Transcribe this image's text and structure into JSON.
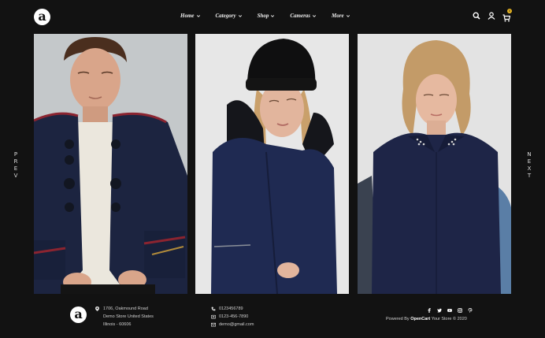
{
  "header": {
    "logo_letter": "a",
    "nav": [
      {
        "label": "Home"
      },
      {
        "label": "Category"
      },
      {
        "label": "Shop"
      },
      {
        "label": "Cameras"
      },
      {
        "label": "More"
      }
    ],
    "icons": [
      "search-icon",
      "user-icon",
      "cart-icon"
    ],
    "cart_count": "0"
  },
  "slider": {
    "prev_label": [
      "P",
      "R",
      "E",
      "V"
    ],
    "next_label": [
      "N",
      "E",
      "X",
      "T"
    ],
    "panels": [
      "model-photo-man-navy-jacket",
      "model-photo-woman-beanie-coat",
      "model-photo-woman-navy-shirt"
    ]
  },
  "footer": {
    "logo_letter": "a",
    "address": [
      "1706, Oakmound Road",
      "Demo Store United States",
      "Illinois - 60606"
    ],
    "phone": "0123456789",
    "fax": "0123-456-7890",
    "email": "demo@gmail.com",
    "social": [
      "facebook-icon",
      "twitter-icon",
      "youtube-icon",
      "instagram-icon",
      "pinterest-icon"
    ],
    "powered_prefix": "Powered By",
    "powered_brand": "OpenCart",
    "powered_suffix": "Your Store © 2020"
  },
  "colors": {
    "background": "#121212",
    "accent": "#e6b422",
    "navy": "#1c2440"
  }
}
